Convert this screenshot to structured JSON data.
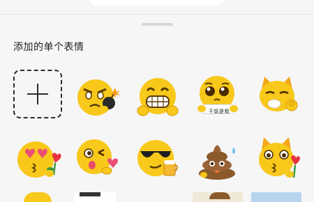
{
  "sheet": {
    "section_title": "添加的单个表情"
  },
  "stickers": {
    "add": {
      "icon": "plus-icon"
    },
    "row1": [
      {
        "name": "angry-bomb-emoji"
      },
      {
        "name": "grinning-teeth-emoji"
      },
      {
        "name": "pleading-sign-emoji",
        "sign_text": "干饭是我"
      },
      {
        "name": "cat-ok-emoji"
      }
    ],
    "row2": [
      {
        "name": "heart-eyes-rose-emoji"
      },
      {
        "name": "wink-kiss-heart-emoji"
      },
      {
        "name": "sunglasses-beer-emoji"
      },
      {
        "name": "poop-sweat-emoji"
      },
      {
        "name": "cat-kiss-rose-emoji"
      }
    ]
  },
  "colors": {
    "emoji_yellow": "#f8c81b",
    "emoji_dark": "#d79a07",
    "cat_orange": "#f2a81a",
    "poop_brown": "#8b5a2b",
    "heart_pink": "#ec4f75"
  }
}
